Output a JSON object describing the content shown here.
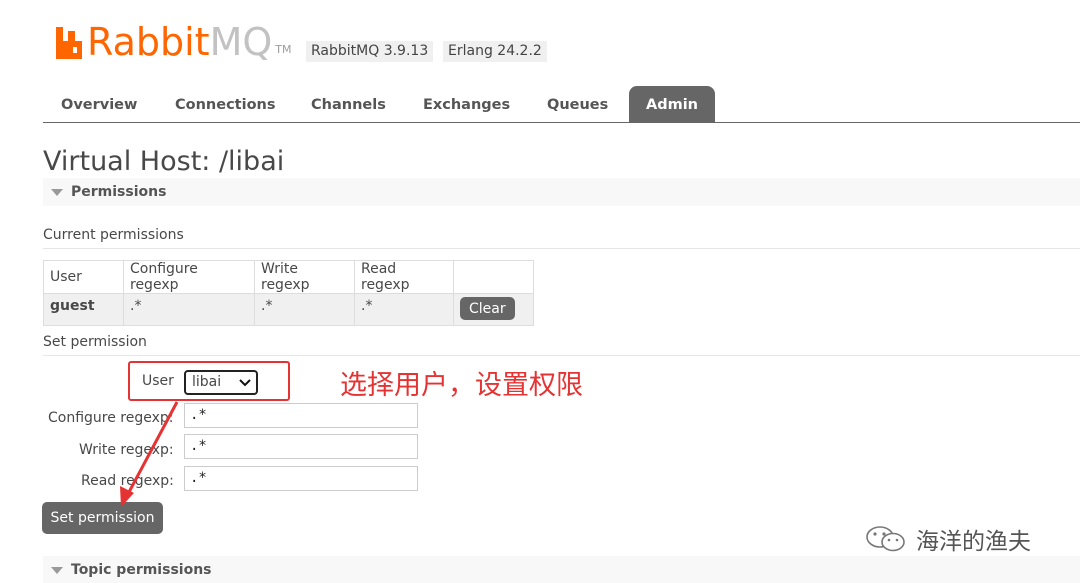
{
  "logo": {
    "part1": "Rabbit",
    "part2": "MQ",
    "tm": "TM"
  },
  "versions": {
    "rabbitmq": "RabbitMQ 3.9.13",
    "erlang": "Erlang 24.2.2"
  },
  "nav": {
    "tabs": [
      {
        "label": "Overview",
        "active": false
      },
      {
        "label": "Connections",
        "active": false
      },
      {
        "label": "Channels",
        "active": false
      },
      {
        "label": "Exchanges",
        "active": false
      },
      {
        "label": "Queues",
        "active": false
      },
      {
        "label": "Admin",
        "active": true
      }
    ]
  },
  "page": {
    "title": "Virtual Host: /libai"
  },
  "permissions": {
    "section_label": "Permissions",
    "current_heading": "Current permissions",
    "table": {
      "headers": [
        "User",
        "Configure regexp",
        "Write regexp",
        "Read regexp"
      ],
      "rows": [
        {
          "user": "guest",
          "configure": ".*",
          "write": ".*",
          "read": ".*",
          "action": "Clear"
        }
      ]
    },
    "set_heading": "Set permission",
    "form": {
      "user_label": "User",
      "user_value": "libai",
      "configure_label": "Configure regexp:",
      "configure_value": ".*",
      "write_label": "Write regexp:",
      "write_value": ".*",
      "read_label": "Read regexp:",
      "read_value": ".*",
      "submit_label": "Set permission"
    }
  },
  "topic_permissions": {
    "section_label": "Topic permissions"
  },
  "annotation": {
    "text": "选择用户，设置权限",
    "color": "#e53333"
  },
  "watermark": {
    "text": "海洋的渔夫"
  },
  "colors": {
    "brand_orange": "#ff6600",
    "nav_active_bg": "#666666",
    "button_bg": "#666666"
  }
}
